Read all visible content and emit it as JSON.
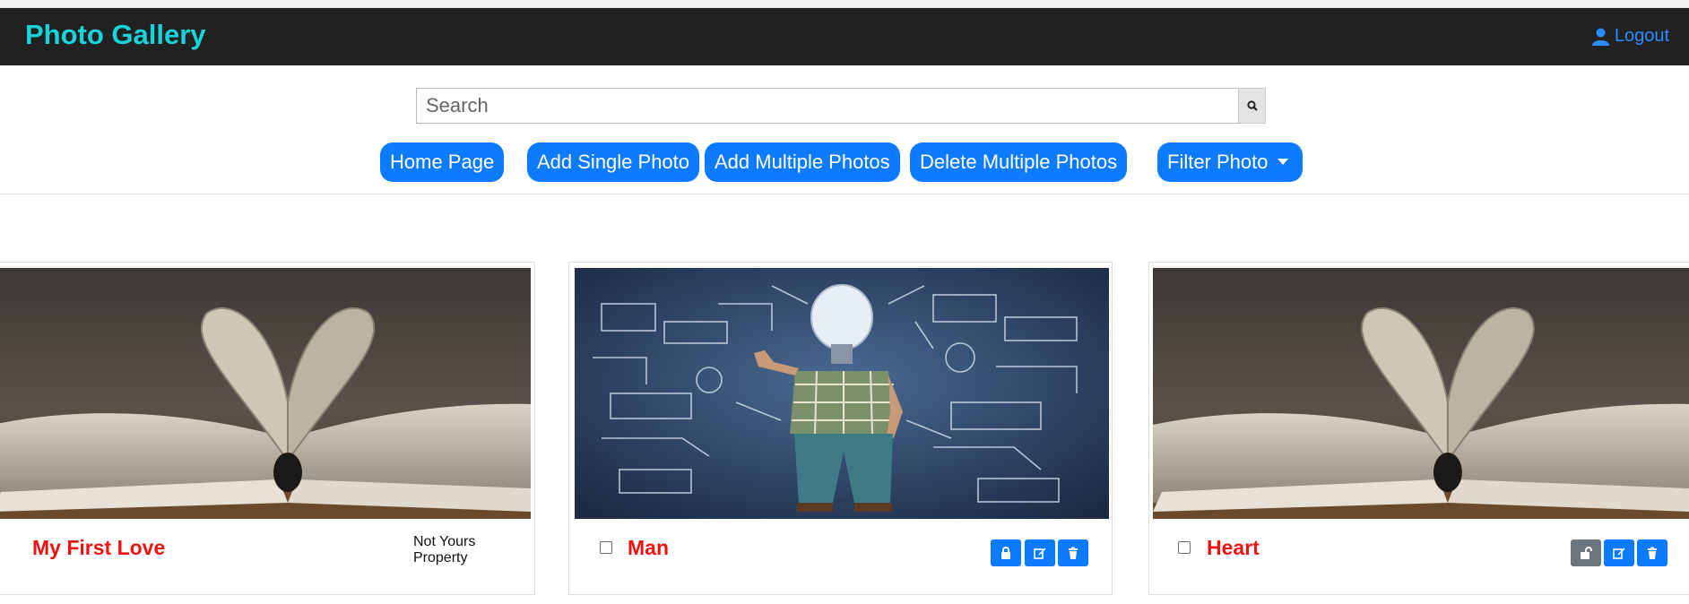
{
  "navbar": {
    "brand": "Photo Gallery",
    "logout_label": "Logout",
    "logout_icon": "user-icon"
  },
  "search": {
    "placeholder": "Search",
    "value": "",
    "icon": "search-icon"
  },
  "toolbar": {
    "home_label": "Home Page",
    "add_single_label": "Add Single Photo",
    "add_multiple_label": "Add Multiple Photos",
    "delete_multiple_label": "Delete Multiple Photos",
    "filter_label": "Filter Photo"
  },
  "cards": [
    {
      "title": "My First Love",
      "owner_note": "Not Yours Property",
      "image": "open-book-heart-pages"
    },
    {
      "title": "Man",
      "image": "lightbulb-head-man-with-sketches",
      "checked": false,
      "actions": [
        "lock-icon",
        "edit-icon",
        "trash-icon"
      ]
    },
    {
      "title": "Heart",
      "image": "open-book-heart-pages",
      "checked": false,
      "actions": [
        "unlock-icon",
        "edit-icon",
        "trash-icon"
      ]
    }
  ],
  "colors": {
    "navbar_bg": "#212121",
    "brand": "#19d3da",
    "accent": "#0d7bff",
    "title_red": "#ef1212",
    "unlock_grey": "#6c757d"
  }
}
